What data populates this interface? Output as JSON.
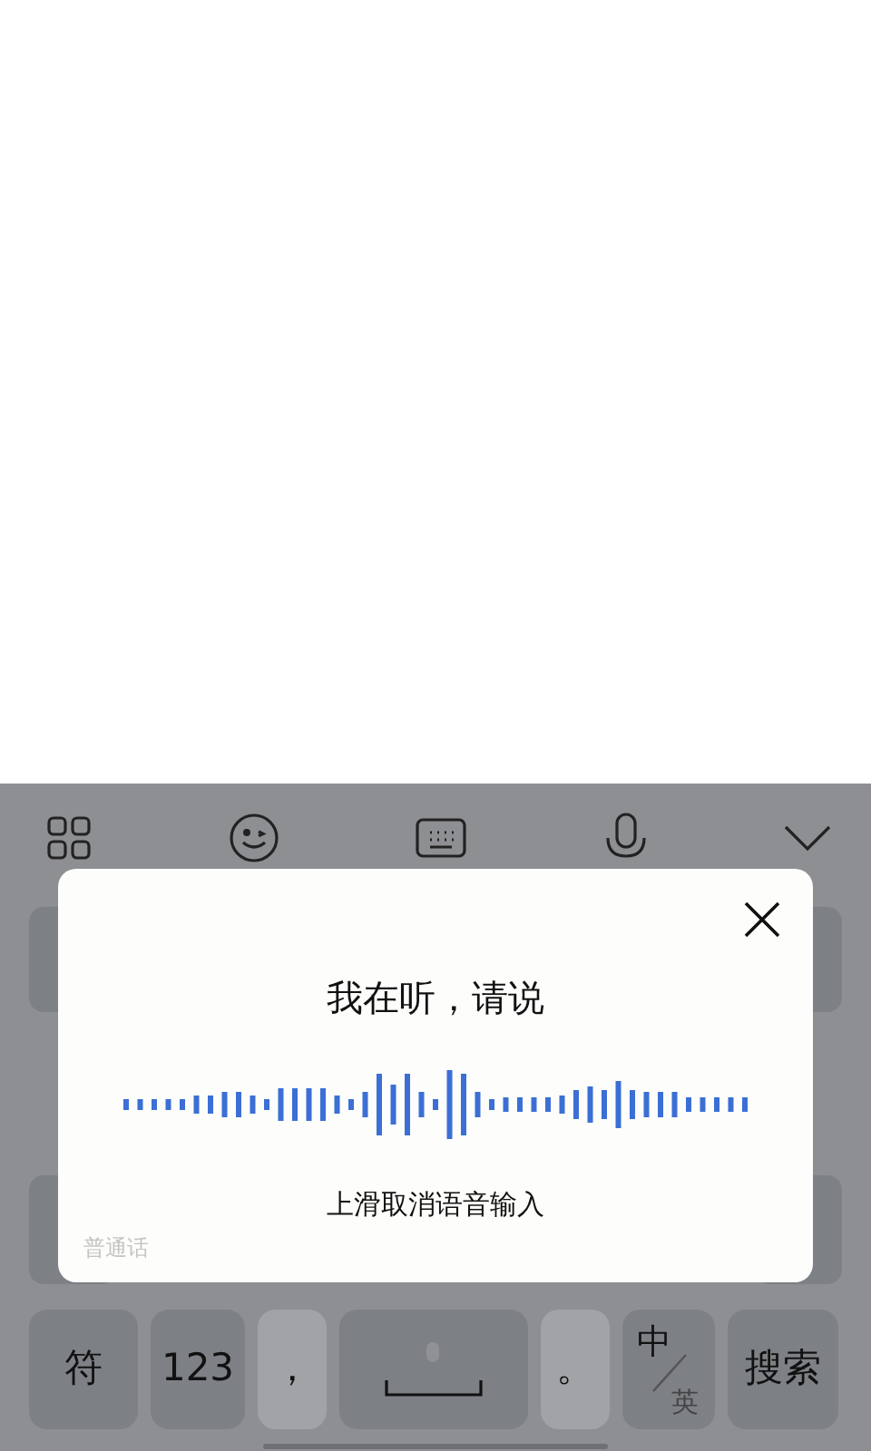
{
  "voice_dialog": {
    "title": "我在听，请说",
    "hint": "上滑取消语音输入",
    "language": "普通话"
  },
  "bottom_keys": [
    {
      "kind": "dark",
      "label": "符"
    },
    {
      "kind": "dark",
      "label": "123"
    },
    {
      "kind": "light",
      "label": "，"
    },
    {
      "kind": "space"
    },
    {
      "kind": "light",
      "label": "。"
    },
    {
      "kind": "switch",
      "label": "中",
      "sub_label": "英"
    },
    {
      "kind": "dark",
      "label": "搜索"
    }
  ]
}
